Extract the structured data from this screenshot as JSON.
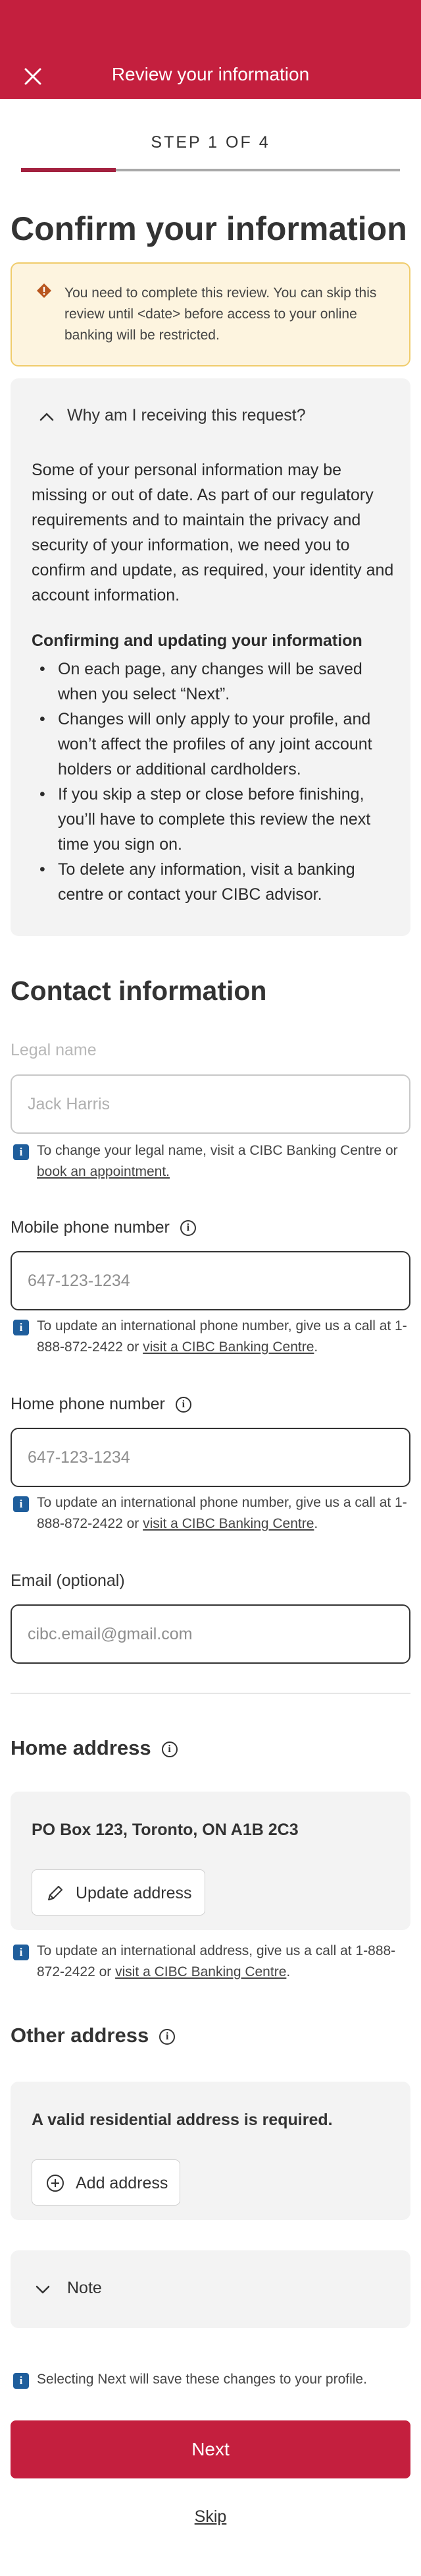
{
  "header": {
    "title": "Review your information"
  },
  "progress": {
    "step_label": "STEP 1 OF 4",
    "fraction": 0.25
  },
  "page_title": "Confirm your information",
  "warning": {
    "text": "You need to complete this review. You can skip this review until <date> before access to your online banking will be restricted."
  },
  "why": {
    "label": "Why am I receiving this request?",
    "paragraph": "Some of your personal information may be missing or out of date. As part of our regulatory requirements and to maintain the privacy and security of your information, we need you to confirm and update, as required, your identity and account information.",
    "subheading": "Confirming and updating your information",
    "bullets": [
      "On each page, any changes will be saved when you select “Next”.",
      "Changes will only apply to your profile, and won’t affect the profiles of any joint account holders or additional cardholders.",
      "If you skip a step or close before finishing, you’ll have to complete this review the next time you sign on.",
      "To delete any information, visit a banking centre or contact your CIBC advisor."
    ]
  },
  "contact": {
    "heading": "Contact information",
    "legal_name": {
      "label": "Legal name",
      "placeholder": "Jack Harris",
      "note_text": "To change your legal name, visit a CIBC Banking Centre or ",
      "note_link": "book an appointment."
    },
    "mobile": {
      "label": "Mobile phone number",
      "placeholder": "647-123-1234",
      "note_text": "To update an international phone number, give us a call at 1-888-872-2422 or ",
      "note_link": "visit a CIBC Banking Centre",
      "note_end": "."
    },
    "home_phone": {
      "label": "Home phone number",
      "placeholder": "647-123-1234",
      "note_text": "To update an international phone number, give us a call at 1-888-872-2422 or ",
      "note_link": "visit a CIBC Banking Centre",
      "note_end": "."
    },
    "email": {
      "label": "Email (optional)",
      "placeholder": "cibc.email@gmail.com"
    }
  },
  "home_address": {
    "heading": "Home address",
    "value": "PO Box 123, Toronto, ON A1B 2C3",
    "button": "Update address",
    "note_text": "To update an international address, give us a call at 1-888-872-2422 or ",
    "note_link": "visit a CIBC Banking Centre",
    "note_end": "."
  },
  "other_address": {
    "heading": "Other address",
    "message": "A valid residential address is required.",
    "button": "Add address"
  },
  "note_toggle": {
    "label": "Note"
  },
  "footer_note": "Selecting Next will save these changes to your profile.",
  "actions": {
    "next": "Next",
    "skip": "Skip"
  },
  "colors": {
    "brand": "#c41f3e",
    "info": "#1f5e9c",
    "warning_bg": "#fdf4df",
    "warning_border": "#f0cc6c",
    "warning_icon": "#b8561f"
  }
}
